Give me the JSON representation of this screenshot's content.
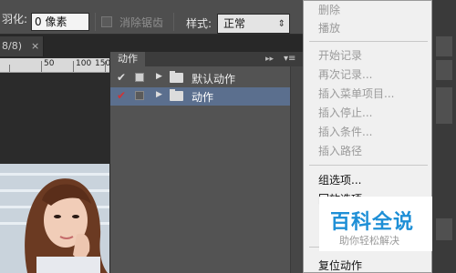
{
  "options_bar": {
    "feather_label": "羽化:",
    "feather_value": "0 像素",
    "antialias_label": "消除锯齿",
    "style_label": "样式:",
    "style_value": "正常"
  },
  "document": {
    "tab_label": "8/8)",
    "close_glyph": "×",
    "ruler_ticks": [
      "50",
      "100",
      "150"
    ]
  },
  "actions_panel": {
    "tab_label": "动作",
    "rows": [
      {
        "label": "默认动作",
        "check_color": "#dddddd",
        "selected": false
      },
      {
        "label": "动作",
        "check_color": "#d23232",
        "selected": true
      }
    ]
  },
  "context_menu": {
    "groups": [
      [
        {
          "label": "删除",
          "enabled": false
        },
        {
          "label": "播放",
          "enabled": false
        }
      ],
      [
        {
          "label": "开始记录",
          "enabled": false
        },
        {
          "label": "再次记录...",
          "enabled": false
        },
        {
          "label": "插入菜单项目...",
          "enabled": false
        },
        {
          "label": "插入停止...",
          "enabled": false
        },
        {
          "label": "插入条件...",
          "enabled": false
        },
        {
          "label": "插入路径",
          "enabled": false
        }
      ],
      [
        {
          "label": "组选项...",
          "enabled": true
        },
        {
          "label": "回放选项...",
          "enabled": true
        }
      ],
      [
        {
          "label": "复位动作",
          "enabled": true
        }
      ]
    ]
  },
  "watermark": {
    "title": "百科全说",
    "subtitle": "助你轻松解决"
  },
  "colors": {
    "selection": "#5b6f8e",
    "accent": "#1e8fd6"
  }
}
